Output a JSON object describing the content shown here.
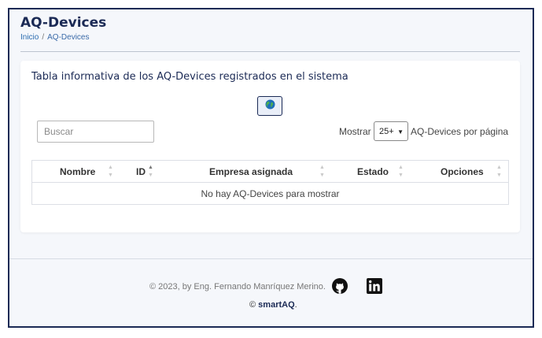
{
  "header": {
    "title": "AQ-Devices",
    "breadcrumb": {
      "home": "Inicio",
      "separator": "/",
      "current": "AQ-Devices"
    }
  },
  "card": {
    "title": "Tabla informativa de los AQ-Devices registrados en el sistema",
    "globe_button_icon": "globe-icon",
    "search": {
      "placeholder": "Buscar",
      "value": ""
    },
    "show_label": "Mostrar",
    "page_size": {
      "selected": "25+"
    },
    "per_page_label": "AQ-Devices por página",
    "table": {
      "columns": [
        "Nombre",
        "ID",
        "Empresa asignada",
        "Estado",
        "Opciones"
      ],
      "empty_message": "No hay AQ-Devices para mostrar"
    }
  },
  "footer": {
    "copyright": "© 2023, by Eng. Fernando Manríquez Merino.",
    "brand_prefix": "©",
    "brand_name": "smartAQ",
    "brand_suffix": ".",
    "social_icons": [
      "github-icon",
      "linkedin-icon"
    ]
  },
  "colors": {
    "primary": "#1b2a55",
    "link": "#2b6cb0",
    "background": "#f5f7fb"
  }
}
